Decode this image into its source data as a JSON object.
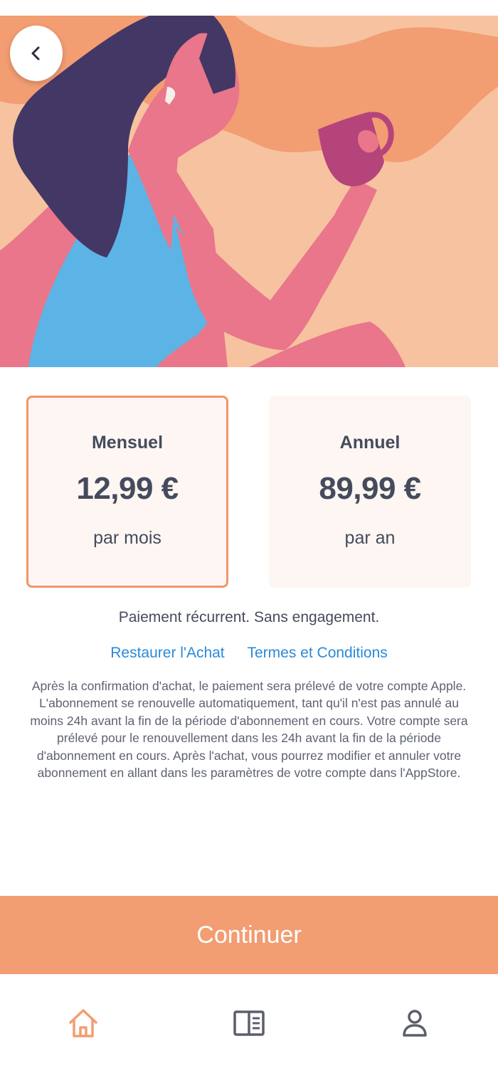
{
  "header": {
    "back_icon": "chevron-left-icon"
  },
  "plans": [
    {
      "name": "Mensuel",
      "price": "12,99 €",
      "period": "par mois",
      "selected": true
    },
    {
      "name": "Annuel",
      "price": "89,99 €",
      "period": "par an",
      "selected": false
    }
  ],
  "recurring_text": "Paiement récurrent. Sans engagement.",
  "links": {
    "restore": "Restaurer l'Achat",
    "terms": "Termes et Conditions"
  },
  "legal_text": "Après la confirmation d'achat, le paiement sera prélevé de votre compte Apple. L'abonnement se renouvelle automatiquement, tant qu'il n'est pas annulé au moins 24h avant la fin de la période d'abonnement en cours. Votre compte sera prélevé pour le renouvellement dans les 24h avant la fin de la période d'abonnement en cours. Après l'achat, vous pourrez modifier et annuler votre abonnement en allant dans les paramètres de votre compte dans l'AppStore.",
  "continue_label": "Continuer",
  "tabbar": {
    "items": [
      {
        "icon": "home-icon",
        "active": true
      },
      {
        "icon": "reader-icon",
        "active": false
      },
      {
        "icon": "profile-icon",
        "active": false
      }
    ]
  },
  "colors": {
    "accent": "#f29d72",
    "selected_border": "#f2956a",
    "card_bg": "#fdf6f3",
    "link": "#2a8ad8",
    "text": "#454b5c"
  }
}
